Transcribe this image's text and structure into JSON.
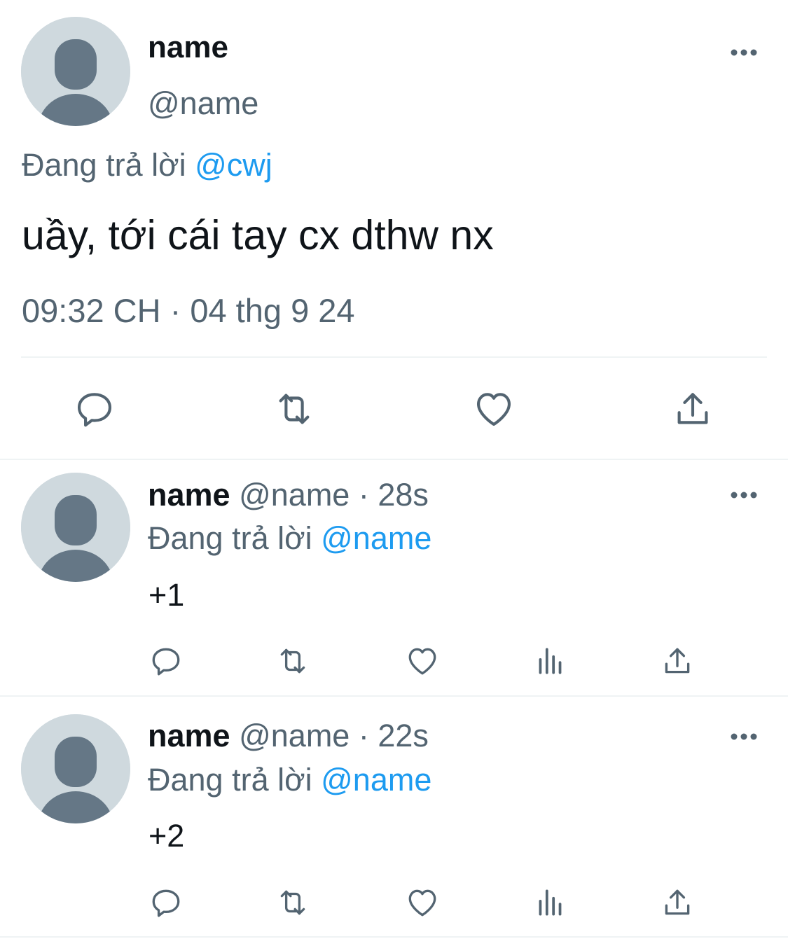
{
  "main_tweet": {
    "display_name": "name",
    "handle": "@name",
    "replying_prefix": "Đang trả lời ",
    "replying_to": "@cwj",
    "text": "uầy, tới cái tay cx dthw nx",
    "time": "09:32 CH",
    "separator": " · ",
    "date": "04 thg 9 24",
    "actions": [
      "reply-icon",
      "retweet-icon",
      "like-icon",
      "share-icon"
    ]
  },
  "replies": [
    {
      "display_name": "name",
      "handle": "@name",
      "separator": " · ",
      "age": "28s",
      "replying_prefix": "Đang trả lời ",
      "replying_to": "@name",
      "text": "+1",
      "actions": [
        "reply-icon",
        "retweet-icon",
        "like-icon",
        "views-icon",
        "share-icon"
      ]
    },
    {
      "display_name": "name",
      "handle": "@name",
      "separator": " · ",
      "age": "22s",
      "replying_prefix": "Đang trả lời ",
      "replying_to": "@name",
      "text": "+2",
      "actions": [
        "reply-icon",
        "retweet-icon",
        "like-icon",
        "views-icon",
        "share-icon"
      ]
    }
  ],
  "colors": {
    "text_primary": "#0f1419",
    "text_secondary": "#536471",
    "mention": "#1d9bf0",
    "avatar_bg": "#cfd9de",
    "avatar_fg": "#657786",
    "divider": "#eff3f4"
  }
}
